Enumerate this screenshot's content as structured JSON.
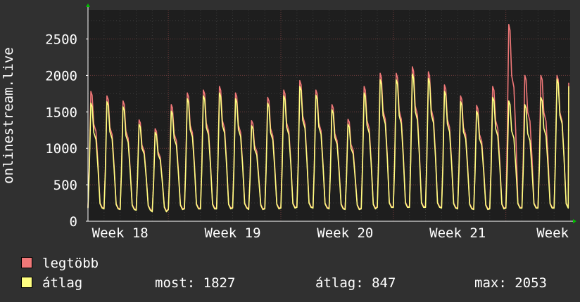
{
  "chart_data": {
    "type": "line",
    "ylabel": "onlinestream.live",
    "ylim": [
      0,
      2900
    ],
    "yticks": [
      0,
      500,
      1000,
      1500,
      2000,
      2500
    ],
    "xticks": [
      "Week 18",
      "Week 19",
      "Week 20",
      "Week 21",
      "Week"
    ],
    "grid": true,
    "background": "#1e1e1e",
    "grid_color": "#5a3a3a",
    "series": [
      {
        "name": "legtöbb",
        "color": "#f07878",
        "days": 30,
        "daily_peak": [
          1780,
          1720,
          1650,
          1390,
          1270,
          1600,
          1760,
          1800,
          1850,
          1760,
          1380,
          1700,
          1800,
          1930,
          1800,
          1600,
          1400,
          1850,
          2030,
          2030,
          2120,
          2050,
          1870,
          1720,
          1590,
          1850,
          2700,
          2000,
          2000,
          2000
        ],
        "daily_min": [
          190,
          180,
          170,
          160,
          140,
          170,
          180,
          180,
          180,
          190,
          170,
          180,
          190,
          200,
          190,
          180,
          170,
          180,
          200,
          200,
          200,
          200,
          190,
          180,
          170,
          180,
          190,
          190,
          190,
          190
        ]
      },
      {
        "name": "átlag",
        "color": "#ffff80",
        "days": 30,
        "daily_peak": [
          1620,
          1640,
          1570,
          1330,
          1220,
          1510,
          1680,
          1720,
          1760,
          1680,
          1310,
          1620,
          1720,
          1850,
          1730,
          1530,
          1330,
          1760,
          1940,
          1940,
          2020,
          1960,
          1780,
          1640,
          1510,
          1700,
          1650,
          1600,
          1700,
          1950
        ],
        "daily_min": [
          180,
          170,
          160,
          150,
          130,
          160,
          170,
          170,
          170,
          180,
          160,
          170,
          180,
          190,
          180,
          170,
          160,
          170,
          190,
          190,
          190,
          190,
          180,
          170,
          160,
          170,
          180,
          180,
          180,
          180
        ]
      }
    ]
  },
  "legend": {
    "max_label": "legtöbb",
    "avg_label": "átlag",
    "max_color": "#f07878",
    "avg_color": "#ffff80"
  },
  "stats": {
    "now": "most: 1827",
    "average": "átlag: 847",
    "max": "max: 2053"
  }
}
